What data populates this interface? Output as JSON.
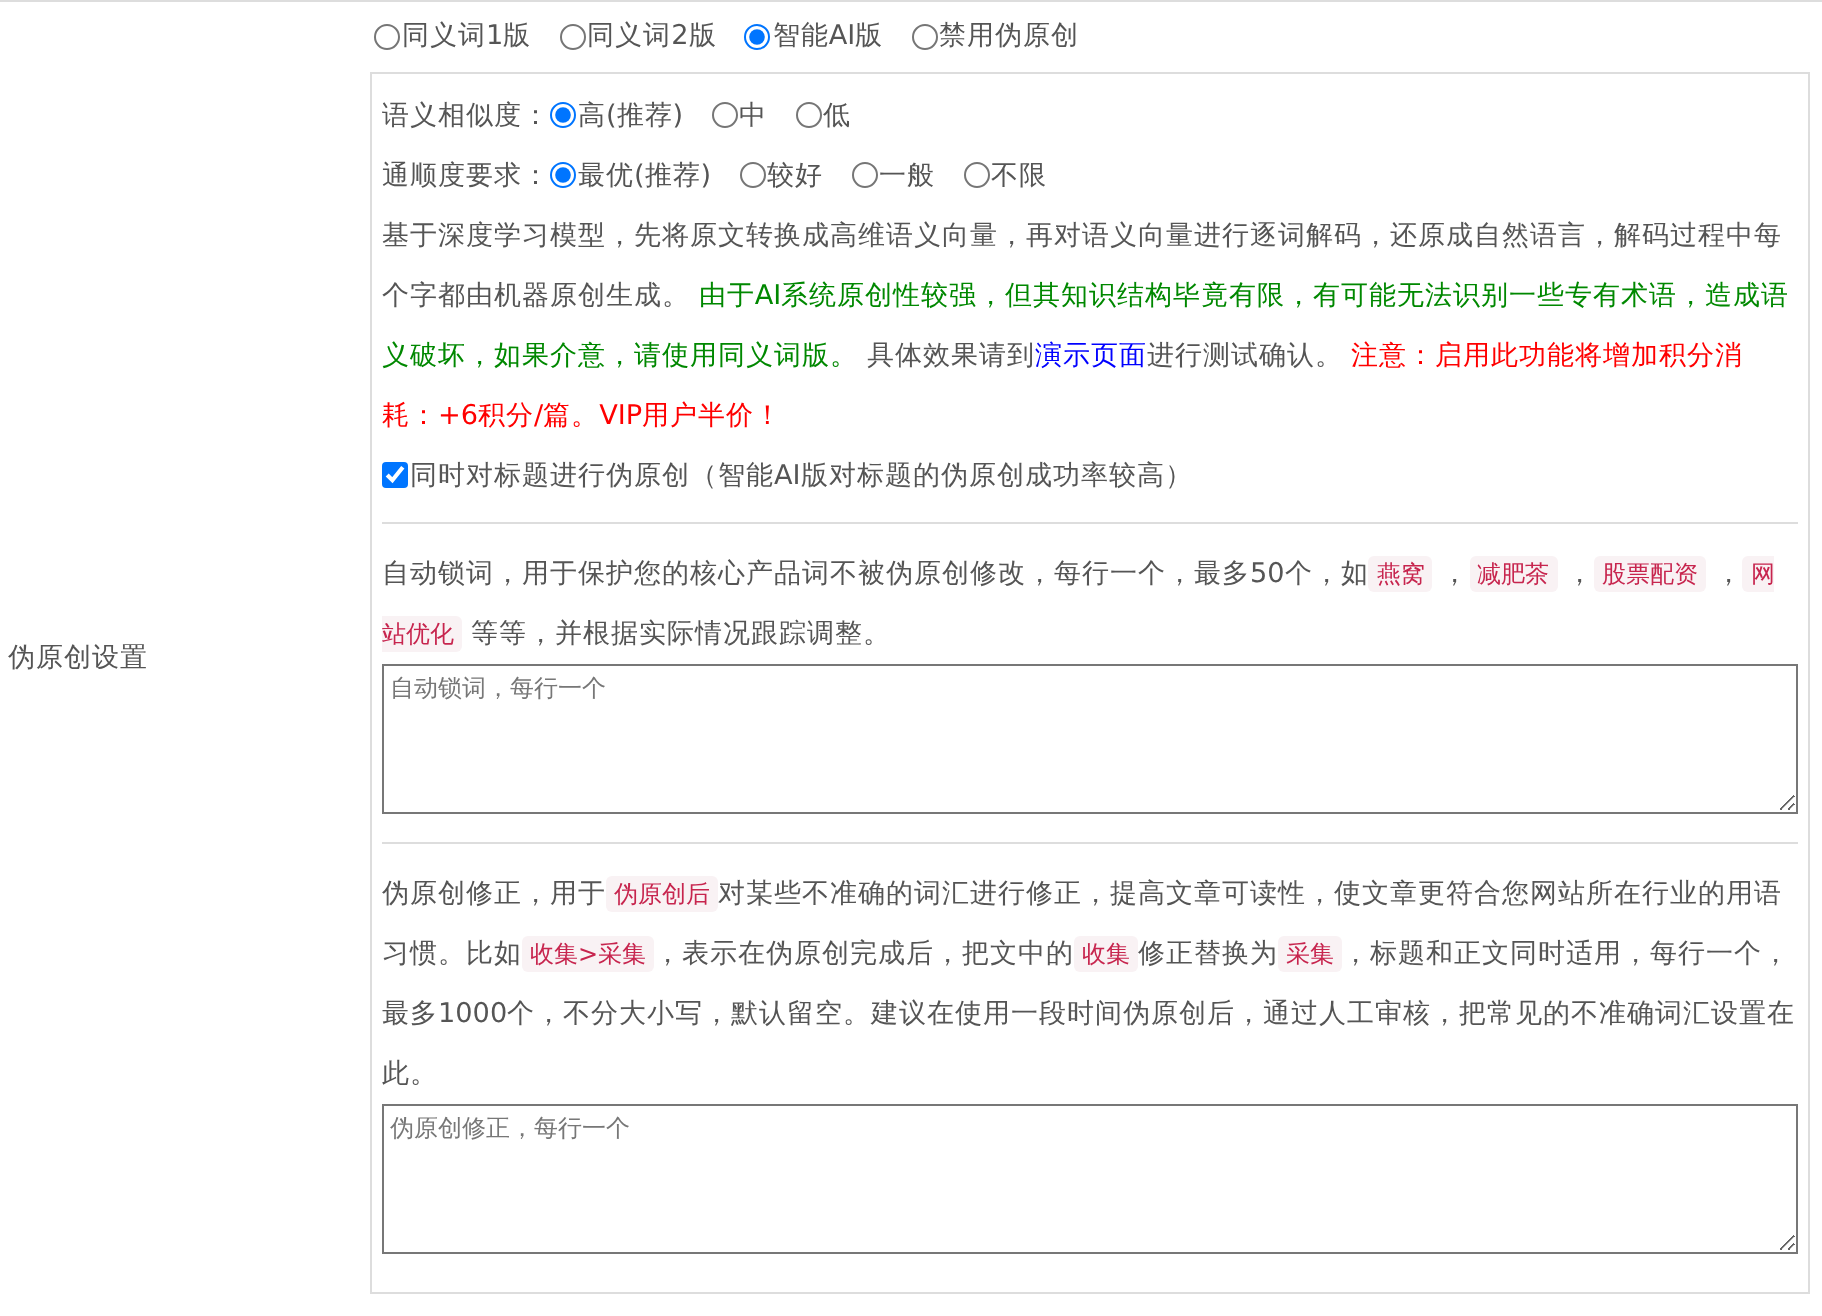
{
  "section_label": "伪原创设置",
  "modes": [
    {
      "label": "同义词1版",
      "selected": false
    },
    {
      "label": "同义词2版",
      "selected": false
    },
    {
      "label": "智能AI版",
      "selected": true
    },
    {
      "label": "禁用伪原创",
      "selected": false
    }
  ],
  "similarity": {
    "label": "语义相似度：",
    "options": [
      {
        "label": "高(推荐)",
        "selected": true
      },
      {
        "label": "中",
        "selected": false
      },
      {
        "label": "低",
        "selected": false
      }
    ]
  },
  "fluency": {
    "label": "通顺度要求：",
    "options": [
      {
        "label": "最优(推荐)",
        "selected": true
      },
      {
        "label": "较好",
        "selected": false
      },
      {
        "label": "一般",
        "selected": false
      },
      {
        "label": "不限",
        "selected": false
      }
    ]
  },
  "ai_description": [
    {
      "kind": "text",
      "text": "基于深度学习模型，先将原文转换成高维语义向量，再对语义向量进行逐词解码，还原成自然语言，解码过程中每个字都由机器原创生成。 "
    },
    {
      "kind": "warning",
      "text": "由于AI系统原创性较强，但其知识结构毕竟有限，有可能无法识别一些专有术语，造成语义破坏，如果介意，请使用同义词版。"
    },
    {
      "kind": "text",
      "text": " 具体效果请到"
    },
    {
      "kind": "link",
      "text": "演示页面"
    },
    {
      "kind": "text",
      "text": "进行测试确认。 "
    },
    {
      "kind": "alert",
      "text": "注意：启用此功能将增加积分消耗：+6积分/篇。VIP用户半价！"
    }
  ],
  "title_option": {
    "label": "同时对标题进行伪原创（智能AI版对标题的伪原创成功率较高）",
    "checked": true
  },
  "lock_words": {
    "description": [
      {
        "kind": "text",
        "text": "自动锁词，用于保护您的核心产品词不被伪原创修改，每行一个，最多50个，如"
      },
      {
        "kind": "code",
        "text": "燕窝"
      },
      {
        "kind": "text",
        "text": " ，"
      },
      {
        "kind": "code",
        "text": "减肥茶"
      },
      {
        "kind": "text",
        "text": " ，"
      },
      {
        "kind": "code",
        "text": "股票配资"
      },
      {
        "kind": "text",
        "text": " ，"
      },
      {
        "kind": "code",
        "text": "网站优化"
      },
      {
        "kind": "text",
        "text": " 等等，并根据实际情况跟踪调整。"
      }
    ],
    "placeholder": "自动锁词，每行一个"
  },
  "correction": {
    "description": [
      {
        "kind": "text",
        "text": "伪原创修正，用于"
      },
      {
        "kind": "code",
        "text": "伪原创后"
      },
      {
        "kind": "text",
        "text": "对某些不准确的词汇进行修正，提高文章可读性，使文章更符合您网站所在行业的用语习惯。比如"
      },
      {
        "kind": "code",
        "text": "收集>采集"
      },
      {
        "kind": "text",
        "text": "，表示在伪原创完成后，把文中的"
      },
      {
        "kind": "code",
        "text": "收集"
      },
      {
        "kind": "text",
        "text": "修正替换为"
      },
      {
        "kind": "code",
        "text": "采集"
      },
      {
        "kind": "text",
        "text": "，标题和正文同时适用，每行一个，最多1000个，不分大小写，默认留空。建议在使用一段时间伪原创后，通过人工审核，把常见的不准确词汇设置在此。"
      }
    ],
    "placeholder": "伪原创修正，每行一个"
  }
}
